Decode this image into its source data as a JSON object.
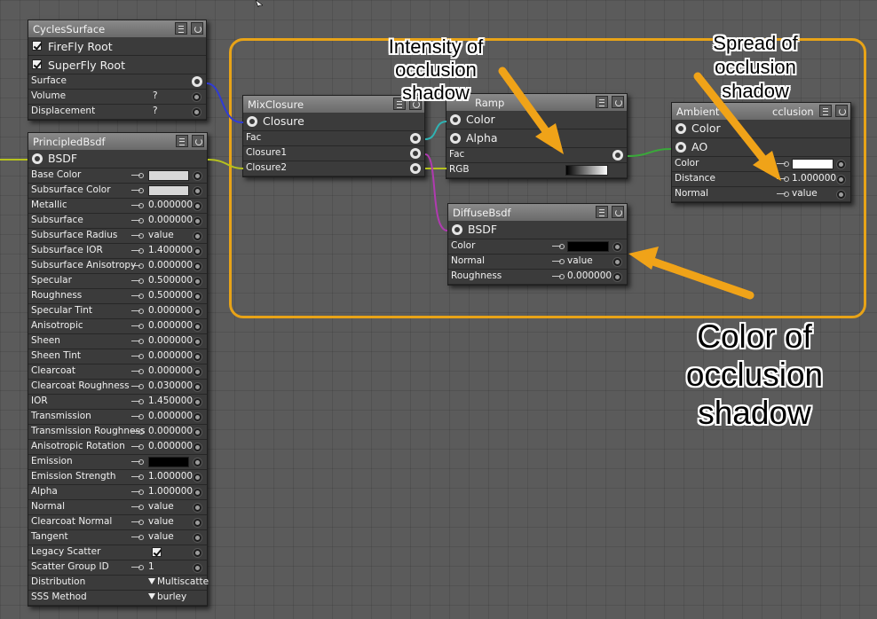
{
  "cycles_surface": {
    "title": "CyclesSurface",
    "rows": [
      {
        "label": "FireFly Root",
        "checked": true
      },
      {
        "label": "SuperFly Root",
        "checked": true
      }
    ],
    "surface_label": "Surface",
    "volume_label": "Volume",
    "volume_value": "?",
    "displacement_label": "Displacement",
    "displacement_value": "?"
  },
  "principled": {
    "title": "PrincipledBsdf",
    "output_label": "BSDF",
    "rows": [
      {
        "label": "Base Color",
        "kind": "color",
        "color": "#d8d8d8"
      },
      {
        "label": "Subsurface Color",
        "kind": "color",
        "color": "#d8d8d8"
      },
      {
        "label": "Metallic",
        "kind": "value",
        "value": "0.000000"
      },
      {
        "label": "Subsurface",
        "kind": "value",
        "value": "0.000000"
      },
      {
        "label": "Subsurface Radius",
        "kind": "value",
        "value": "value"
      },
      {
        "label": "Subsurface IOR",
        "kind": "value",
        "value": "1.400000"
      },
      {
        "label": "Subsurface Anisotropy",
        "kind": "value",
        "value": "0.000000"
      },
      {
        "label": "Specular",
        "kind": "value",
        "value": "0.500000"
      },
      {
        "label": "Roughness",
        "kind": "value",
        "value": "0.500000"
      },
      {
        "label": "Specular Tint",
        "kind": "value",
        "value": "0.000000"
      },
      {
        "label": "Anisotropic",
        "kind": "value",
        "value": "0.000000"
      },
      {
        "label": "Sheen",
        "kind": "value",
        "value": "0.000000"
      },
      {
        "label": "Sheen Tint",
        "kind": "value",
        "value": "0.000000"
      },
      {
        "label": "Clearcoat",
        "kind": "value",
        "value": "0.000000"
      },
      {
        "label": "Clearcoat Roughness",
        "kind": "value",
        "value": "0.030000"
      },
      {
        "label": "IOR",
        "kind": "value",
        "value": "1.450000"
      },
      {
        "label": "Transmission",
        "kind": "value",
        "value": "0.000000"
      },
      {
        "label": "Transmission Roughness",
        "kind": "value",
        "value": "0.000000"
      },
      {
        "label": "Anisotropic Rotation",
        "kind": "value",
        "value": "0.000000"
      },
      {
        "label": "Emission",
        "kind": "color",
        "color": "#000000"
      },
      {
        "label": "Emission Strength",
        "kind": "value",
        "value": "1.000000"
      },
      {
        "label": "Alpha",
        "kind": "value",
        "value": "1.000000"
      },
      {
        "label": "Normal",
        "kind": "value",
        "value": "value"
      },
      {
        "label": "Clearcoat Normal",
        "kind": "value",
        "value": "value"
      },
      {
        "label": "Tangent",
        "kind": "value",
        "value": "value"
      },
      {
        "label": "Legacy Scatter",
        "kind": "check",
        "checked": true
      },
      {
        "label": "Scatter Group ID",
        "kind": "value",
        "value": "1"
      },
      {
        "label": "Distribution",
        "kind": "dropdown",
        "value": "Multiscatte"
      },
      {
        "label": "SSS Method",
        "kind": "dropdown",
        "value": "burley"
      }
    ]
  },
  "mix_closure": {
    "title": "MixClosure",
    "output_label": "Closure",
    "fac_label": "Fac",
    "closure1_label": "Closure1",
    "closure2_label": "Closure2"
  },
  "color_ramp": {
    "title_visible": "Ramp",
    "color_label": "Color",
    "alpha_label": "Alpha",
    "fac_label": "Fac",
    "rgb_label": "RGB"
  },
  "ambient_occlusion": {
    "title_visible": "Ambient",
    "title_visible_end": "cclusion",
    "color_out_label": "Color",
    "ao_label": "AO",
    "color_label": "Color",
    "color_swatch": "#ffffff",
    "distance_label": "Distance",
    "distance_value": "1.000000",
    "normal_label": "Normal",
    "normal_value": "value"
  },
  "diffuse": {
    "title": "DiffuseBsdf",
    "output_label": "BSDF",
    "color_label": "Color",
    "color_swatch": "#000000",
    "normal_label": "Normal",
    "normal_value": "value",
    "roughness_label": "Roughness",
    "roughness_value": "0.000000"
  },
  "annotations": {
    "intensity": "Intensity of occlusion shadow",
    "spread": "Spread of occlusion shadow",
    "color": "Color of occlusion shadow"
  },
  "colors": {
    "highlight": "#e8a317",
    "wire_blue": "#2f3bd6",
    "wire_cyan": "#2fb3b3",
    "wire_green": "#3aa83a",
    "wire_magenta": "#b03ab0",
    "wire_yellow": "#b6c21e"
  }
}
